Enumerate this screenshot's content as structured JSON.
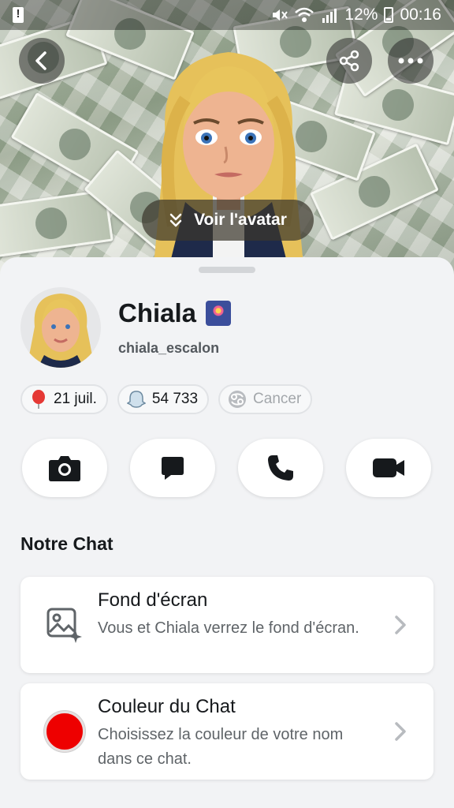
{
  "status_bar": {
    "battery": "12%",
    "time": "00:16",
    "icons": [
      "alert-icon",
      "mute-icon",
      "wifi-icon",
      "signal-icon",
      "battery-icon"
    ]
  },
  "header": {
    "view_avatar_label": "Voir l'avatar",
    "icons": [
      "back-icon",
      "share-icon",
      "more-icon"
    ]
  },
  "profile": {
    "name": "Chiala",
    "username": "chiala_escalon",
    "name_emoji": "fireworks-icon"
  },
  "pills": [
    {
      "icon": "balloon-icon",
      "label": "21 juil."
    },
    {
      "icon": "snap-ghost-icon",
      "label": "54 733"
    },
    {
      "icon": "cancer-zodiac-icon",
      "label": "Cancer"
    }
  ],
  "actions": [
    {
      "name": "camera",
      "icon": "camera-icon"
    },
    {
      "name": "chat",
      "icon": "chat-icon"
    },
    {
      "name": "call",
      "icon": "phone-icon"
    },
    {
      "name": "video",
      "icon": "video-icon"
    }
  ],
  "section": {
    "title": "Notre Chat"
  },
  "cards": {
    "wallpaper": {
      "title": "Fond d'écran",
      "description": "Vous et Chiala verrez le fond d'écran.",
      "icon": "wallpaper-icon"
    },
    "chat_color": {
      "title": "Couleur du Chat",
      "description": "Choisissez la couleur de votre nom dans ce chat.",
      "swatch_color": "#ee0000"
    }
  },
  "colors": {
    "background": "#f2f3f5",
    "text": "#16191c",
    "muted_text": "#5f6468",
    "accent_red": "#ee0000"
  }
}
